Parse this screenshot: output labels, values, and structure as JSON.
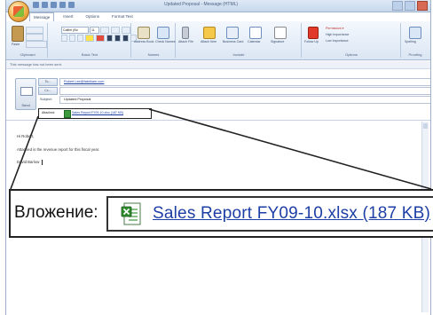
{
  "window": {
    "title": "Updated Proposal - Message (HTML)"
  },
  "tabs": [
    "Message",
    "Insert",
    "Options",
    "Format Text"
  ],
  "ribbon": {
    "groups": [
      "Clipboard",
      "Basic Text",
      "Names",
      "Include",
      "Options",
      "Proofing"
    ],
    "clipboard_paste": "Paste",
    "font_name": "Calibri (Bo",
    "font_size": "11",
    "names_buttons": [
      "Address Book",
      "Check Names"
    ],
    "include_buttons": [
      "Attach File",
      "Attach Item",
      "Business Card",
      "Calendar",
      "Signature"
    ],
    "options_buttons": [
      "Follow Up",
      "High Importance",
      "Low Importance"
    ],
    "proofing_button": "Spelling"
  },
  "infobar": "This message has not been sent.",
  "send_label": "Send",
  "fields": {
    "to_label": "To...",
    "to_value": "Robert.Lee@fabrikam.com",
    "cc_label": "Cc...",
    "cc_value": "",
    "subject_label": "Subject:",
    "subject_value": "Updated Proposal",
    "attached_label": "Attached:",
    "attached_file": "Sales Report FY09-10.xlsx (187 KB)"
  },
  "body": {
    "greeting": "Hi Robert,",
    "line1": "Attached is the revenue report for this fiscal year.",
    "signature": "David Barlow"
  },
  "callout": {
    "label": "Вложение:",
    "file": "Sales Report FY09-10.xlsx (187 KB)"
  },
  "colors": {
    "ribbon_bg": "#dbe6f4",
    "link": "#1d3fa5",
    "excel_green": "#3d9a3d"
  }
}
